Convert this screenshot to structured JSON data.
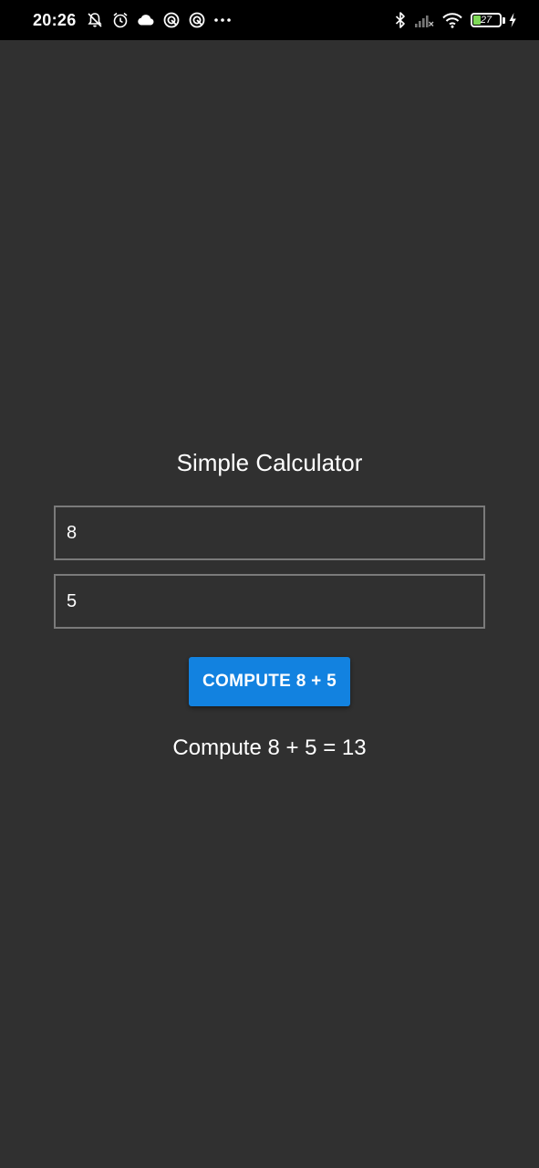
{
  "status_bar": {
    "time": "20:26",
    "battery_level": "27",
    "left_icons": [
      "bell-off-icon",
      "alarm-icon",
      "cloud-icon",
      "sync-icon",
      "sync-icon",
      "more-icon"
    ],
    "right_icons": [
      "bluetooth-icon",
      "signal-icon",
      "wifi-icon",
      "battery-icon",
      "charging-icon"
    ],
    "battery_color": "#7ed957"
  },
  "app": {
    "title": "Simple Calculator",
    "input_a": {
      "value": "8"
    },
    "input_b": {
      "value": "5"
    },
    "compute_button_label": "COMPUTE 8 + 5",
    "result_text": "Compute 8 + 5 = 13",
    "accent_color": "#1282e0",
    "background_color": "#303030"
  }
}
